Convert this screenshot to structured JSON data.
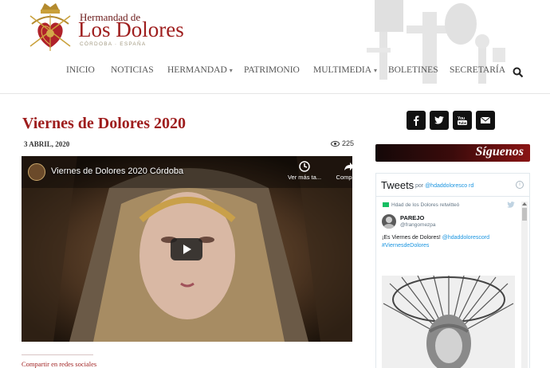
{
  "brand": {
    "small": "Hermandad de",
    "big": "Los Dolores",
    "sub": "CÓRDOBA · ESPAÑA"
  },
  "nav": {
    "items": [
      {
        "label": "INICIO"
      },
      {
        "label": "NOTICIAS"
      },
      {
        "label": "HERMANDAD"
      },
      {
        "label": "PATRIMONIO"
      },
      {
        "label": "MULTIMEDIA"
      },
      {
        "label": "BOLETINES"
      },
      {
        "label": "SECRETARÍA"
      }
    ],
    "search_icon": "search-icon"
  },
  "article": {
    "title": "Viernes de Dolores 2020",
    "date": "3 ABRIL, 2020",
    "views": "225",
    "share_label": "Compartir en redes sociales"
  },
  "video": {
    "title": "Viernes de Dolores 2020 Córdoba",
    "watch_later": "Ver más ta...",
    "share": "Compartir"
  },
  "sidebar": {
    "social_icons": [
      "facebook-icon",
      "twitter-icon",
      "youtube-icon",
      "email-icon"
    ],
    "follow_label": "Síguenos"
  },
  "tweets": {
    "heading": "Tweets",
    "by_prefix": "por",
    "by_handle": "@hdaddoloresco rd",
    "retweeted": "Hdad de los Dolores retwitteó",
    "user_name": "PAREJO",
    "user_handle": "@frangomezpa",
    "text_before": "¡Es Viernes de Dolores! ",
    "mention": "@hdaddolorescord",
    "hashtag": "#ViernesdeDolores"
  },
  "colors": {
    "brand_red": "#9e1d1d",
    "twitter_blue": "#1b95e0"
  }
}
